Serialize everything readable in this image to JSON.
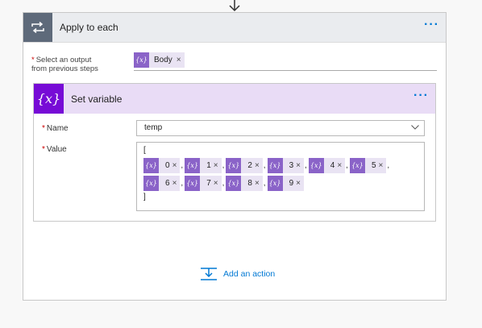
{
  "apply": {
    "title": "Apply to each",
    "more": "···",
    "select_label_line1": "Select an output",
    "select_label_line2": "from previous steps",
    "body_token": "Body",
    "remove": "×"
  },
  "setvar": {
    "title": "Set variable",
    "icon_text": "{x}",
    "more": "···",
    "name_label": "Name",
    "name_value": "temp",
    "value_label": "Value",
    "open_bracket": "[",
    "close_bracket": "]",
    "separator": ",",
    "token_icon": "{x}",
    "row1": [
      "0",
      "1",
      "2",
      "3",
      "4",
      "5"
    ],
    "row2": [
      "6",
      "7",
      "8",
      "9"
    ]
  },
  "add_action": {
    "label": "Add an action"
  },
  "colors": {
    "accent": "#0078d4",
    "variable_purple": "#770bd6",
    "token_purple": "#8a63c8",
    "required": "#cc0000"
  },
  "icons": {
    "loop": "loop-icon",
    "variable": "variable-icon",
    "chevron": "chevron-down-icon",
    "add_action": "add-action-icon",
    "arrow": "arrow-down-icon"
  }
}
